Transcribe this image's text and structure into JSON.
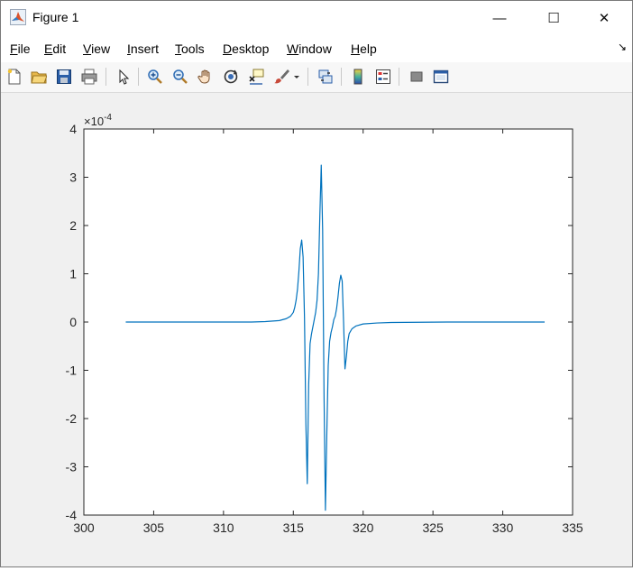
{
  "window": {
    "title": "Figure 1",
    "minimize_glyph": "—",
    "maximize_glyph": "☐",
    "close_glyph": "✕"
  },
  "menu": {
    "items": [
      "File",
      "Edit",
      "View",
      "Insert",
      "Tools",
      "Desktop",
      "Window",
      "Help"
    ],
    "corner_glyph": "↘"
  },
  "toolbar": {
    "icons": [
      "new-figure-icon",
      "open-file-icon",
      "save-icon",
      "print-icon",
      "pointer-icon",
      "zoom-in-icon",
      "zoom-out-icon",
      "pan-hand-icon",
      "rotate-3d-icon",
      "data-cursor-icon",
      "brush-icon",
      "link-plot-icon",
      "colorbar-icon",
      "legend-icon",
      "hide-plot-tools-icon",
      "show-plot-tools-icon"
    ]
  },
  "colors": {
    "line": "#0072bd",
    "axes_background": "#ffffff",
    "figure_background": "#f0f0f0"
  },
  "chart_data": {
    "type": "line",
    "xlim": [
      300,
      335
    ],
    "ylim": [
      -4,
      4
    ],
    "x_ticks": [
      300,
      305,
      310,
      315,
      320,
      325,
      330,
      335
    ],
    "y_ticks": [
      4,
      3,
      2,
      1,
      0,
      -1,
      -2,
      -3,
      -4
    ],
    "y_exponent_base": "×10",
    "y_exponent_power": "-4",
    "grid": false,
    "legend": "none",
    "series": [
      {
        "x": [
          303,
          310,
          312,
          313,
          314,
          314.5,
          314.8,
          315.0,
          315.1,
          315.2,
          315.3,
          315.4,
          315.5,
          315.6,
          315.7,
          315.8,
          315.9,
          316.0,
          316.1,
          316.2,
          316.3,
          316.4,
          316.5,
          316.6,
          316.7,
          316.8,
          316.9,
          317.0,
          317.1,
          317.2,
          317.3,
          317.4,
          317.5,
          317.6,
          317.7,
          317.8,
          317.9,
          318.0,
          318.1,
          318.2,
          318.3,
          318.4,
          318.5,
          318.6,
          318.7,
          318.8,
          318.9,
          319.0,
          319.2,
          319.5,
          320,
          321,
          322,
          324,
          326,
          330,
          333
        ],
        "y": [
          0.0,
          0.0,
          0.0,
          0.01,
          0.03,
          0.07,
          0.12,
          0.2,
          0.3,
          0.45,
          0.68,
          1.05,
          1.52,
          1.7,
          1.35,
          0.1,
          -2.1,
          -3.35,
          -1.3,
          -0.45,
          -0.25,
          -0.1,
          0.05,
          0.2,
          0.45,
          1.0,
          2.2,
          3.25,
          1.9,
          -1.5,
          -3.9,
          -2.3,
          -0.9,
          -0.4,
          -0.22,
          -0.1,
          0.05,
          0.12,
          0.28,
          0.52,
          0.8,
          0.97,
          0.85,
          0.0,
          -0.97,
          -0.72,
          -0.4,
          -0.24,
          -0.14,
          -0.08,
          -0.04,
          -0.02,
          -0.01,
          -0.005,
          0.0,
          0.0,
          0.0
        ]
      }
    ]
  }
}
